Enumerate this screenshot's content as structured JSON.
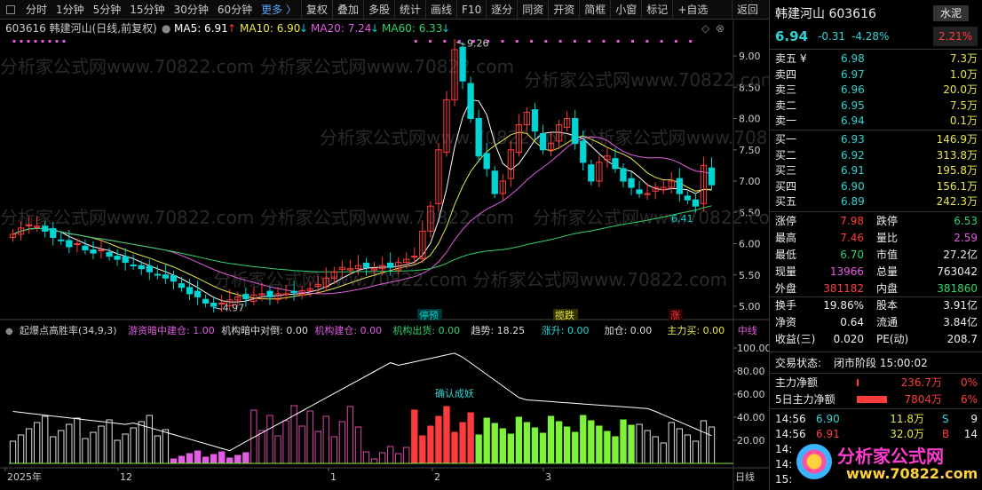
{
  "toolbar": {
    "items": [
      "分时",
      "1分钟",
      "5分钟",
      "15分钟",
      "30分钟",
      "60分钟",
      "更多 〉",
      "复权",
      "叠加",
      "多股",
      "统计",
      "画线",
      "F10",
      "逐分",
      "同资",
      "开资",
      "简框",
      "小窗",
      "标记",
      "+自选",
      "返回"
    ]
  },
  "chart": {
    "header": {
      "code_name": "603616 韩建河山(日线,前复权)",
      "ma5": "MA5: 6.91",
      "ma10": "MA10: 6.90",
      "ma20": "MA20: 7.24",
      "ma60": "MA60: 6.33",
      "arrow_up": "↑",
      "arrow_down": "↓"
    },
    "y_ticks": [
      "9.00",
      "8.50",
      "8.00",
      "7.50",
      "7.00",
      "6.50",
      "6.00",
      "5.50",
      "5.00"
    ],
    "high_label": "9.26",
    "low_label": "4.97",
    "last_low_label": "6.41",
    "signals": [
      "停预",
      "揽跌",
      "涨"
    ],
    "date_labels": [
      "2025年",
      "12",
      "1",
      "2",
      "3"
    ],
    "period_label": "日线",
    "indicator": {
      "name": "起爆点高胜率(34,9,3)",
      "items": [
        {
          "label": "游资暗中建仓:",
          "value": "1.00",
          "color": "#e35ce3"
        },
        {
          "label": "机构暗中对倒:",
          "value": "0.00",
          "color": "#dddddd"
        },
        {
          "label": "机构建仓:",
          "value": "0.00",
          "color": "#e35ce3"
        },
        {
          "label": "机构出货:",
          "value": "0.00",
          "color": "#2fd36b"
        },
        {
          "label": "趋势:",
          "value": "18.25",
          "color": "#dddddd"
        },
        {
          "label": "涨升:",
          "value": "0.00",
          "color": "#2fd3d3"
        },
        {
          "label": "加仓:",
          "value": "0.00",
          "color": "#dddddd"
        },
        {
          "label": "主力买:",
          "value": "0.00",
          "color": "#e8e84a"
        },
        {
          "label": "中线",
          "value": "",
          "color": "#e35ce3"
        }
      ],
      "y_ticks": [
        "100.00",
        "80.00",
        "60.00",
        "40.00",
        "20.00"
      ],
      "annotation": "确认成妖"
    },
    "watermark": "分析家公式网www.70822.com"
  },
  "quote": {
    "name": "韩建河山 603616",
    "industry": "水泥",
    "price": "6.94",
    "change": "-0.31",
    "change_pct": "-4.28%",
    "industry_pct": "2.21%",
    "asks": [
      {
        "label": "卖五",
        "mark": "¥",
        "price": "6.98",
        "vol": "7.3万"
      },
      {
        "label": "卖四",
        "mark": "",
        "price": "6.97",
        "vol": "1.0万"
      },
      {
        "label": "卖三",
        "mark": "",
        "price": "6.96",
        "vol": "20.0万"
      },
      {
        "label": "卖二",
        "mark": "",
        "price": "6.95",
        "vol": "7.5万"
      },
      {
        "label": "卖一",
        "mark": "",
        "price": "6.94",
        "vol": "0.1万"
      }
    ],
    "bids": [
      {
        "label": "买一",
        "price": "6.93",
        "vol": "146.9万"
      },
      {
        "label": "买二",
        "price": "6.92",
        "vol": "313.8万"
      },
      {
        "label": "买三",
        "price": "6.91",
        "vol": "195.8万"
      },
      {
        "label": "买四",
        "price": "6.90",
        "vol": "156.1万"
      },
      {
        "label": "买五",
        "price": "6.89",
        "vol": "242.3万"
      }
    ],
    "stats": [
      {
        "l1": "涨停",
        "v1": "7.98",
        "c1": "red",
        "l2": "跌停",
        "v2": "6.53",
        "c2": "green"
      },
      {
        "l1": "最高",
        "v1": "7.46",
        "c1": "red",
        "l2": "量比",
        "v2": "2.59",
        "c2": "mag"
      },
      {
        "l1": "最低",
        "v1": "6.70",
        "c1": "green",
        "l2": "市值",
        "v2": "27.2亿",
        "c2": "white"
      },
      {
        "l1": "现量",
        "v1": "13966",
        "c1": "mag",
        "l2": "总量",
        "v2": "763042",
        "c2": "white"
      },
      {
        "l1": "外盘",
        "v1": "381182",
        "c1": "red",
        "l2": "内盘",
        "v2": "381860",
        "c2": "green"
      },
      {
        "l1": "换手",
        "v1": "19.86%",
        "c1": "white",
        "l2": "股本",
        "v2": "3.91亿",
        "c2": "white"
      },
      {
        "l1": "净资",
        "v1": "0.64",
        "c1": "white",
        "l2": "流通",
        "v2": "3.84亿",
        "c2": "white"
      },
      {
        "l1": "收益(三)",
        "v1": "0.020",
        "c1": "white",
        "l2": "PE(动)",
        "v2": "208.7",
        "c2": "white"
      }
    ],
    "trade_status_label": "交易状态:",
    "trade_status": "闭市阶段 15:00:02",
    "flows": [
      {
        "label": "主力净额",
        "amount": "236.7万",
        "pct": "0%"
      },
      {
        "label": "5日主力净额",
        "amount": "7804万",
        "pct": "6%"
      }
    ],
    "ticks": [
      {
        "time": "14:56",
        "price": "6.90",
        "vol": "11.8万",
        "side": "S",
        "n": "9"
      },
      {
        "time": "14:56",
        "price": "6.91",
        "vol": "32.0万",
        "side": "B",
        "n": "14"
      },
      {
        "time": "14:5",
        "price": "",
        "vol": "",
        "side": "",
        "n": ""
      },
      {
        "time": "14:5",
        "price": "",
        "vol": "",
        "side": "",
        "n": ""
      },
      {
        "time": "15:0",
        "price": "",
        "vol": "",
        "side": "",
        "n": ""
      }
    ],
    "logo_text": "分析家公式网",
    "logo_url": "www.70822.com"
  },
  "colors": {
    "up": "#ff3b3b",
    "down": "#00d4d4",
    "ma5": "#ffffff",
    "ma10": "#e8e84a",
    "ma20": "#e35ce3",
    "ma60": "#2fd36b"
  }
}
